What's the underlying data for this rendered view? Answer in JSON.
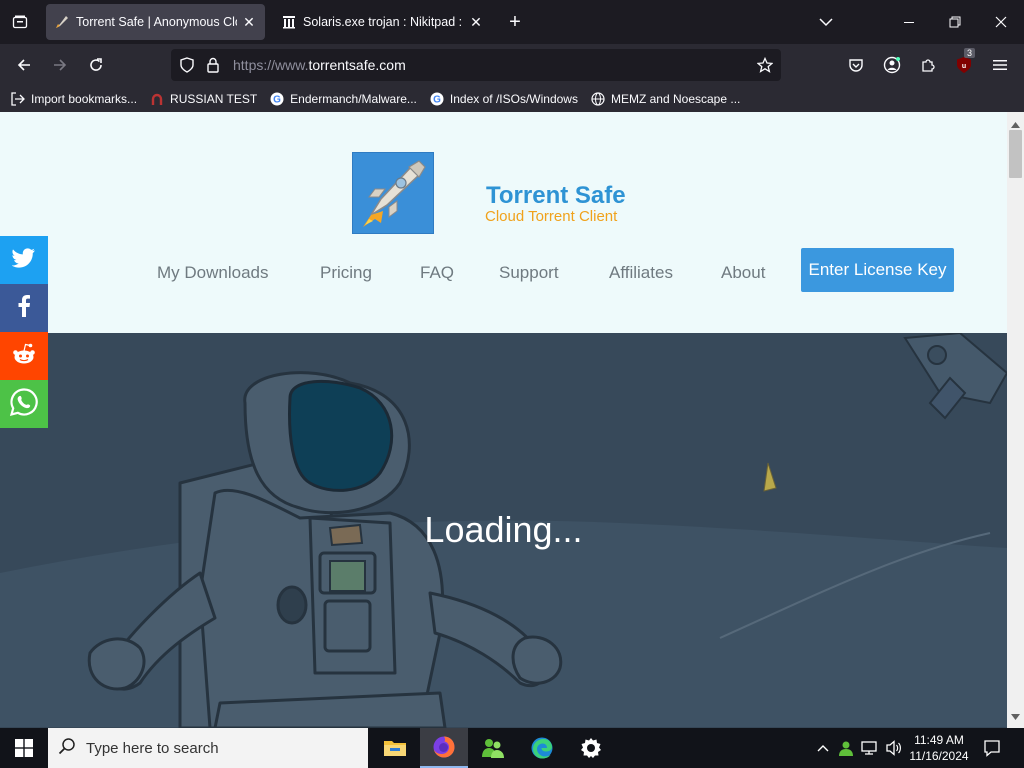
{
  "browser": {
    "tabs": [
      {
        "title": "Torrent Safe | Anonymous Cloud",
        "active": true
      },
      {
        "title": "Solaris.exe trojan : Nikitpad : Fr",
        "active": false
      }
    ],
    "url_prefix": "https://www.",
    "url_domain": "torrentsafe.com",
    "notification_badge": "3",
    "bookmarks": [
      {
        "label": "Import bookmarks...",
        "icon": "import-icon"
      },
      {
        "label": "RUSSIAN TEST",
        "icon": "horseshoe-icon"
      },
      {
        "label": "Endermanch/Malware...",
        "icon": "google-icon"
      },
      {
        "label": "Index of /ISOs/Windows",
        "icon": "google-icon"
      },
      {
        "label": "MEMZ and Noescape ...",
        "icon": "globe-icon"
      }
    ]
  },
  "site": {
    "brand_name": "Torrent Safe",
    "brand_tagline": "Cloud Torrent Client",
    "nav": [
      "My Downloads",
      "Pricing",
      "FAQ",
      "Support",
      "Affiliates",
      "About"
    ],
    "cta": "Enter License Key",
    "loading_text": "Loading...",
    "share": [
      {
        "name": "twitter",
        "color": "#1da1f2"
      },
      {
        "name": "facebook",
        "color": "#3b5998"
      },
      {
        "name": "reddit",
        "color": "#ff4500"
      },
      {
        "name": "whatsapp",
        "color": "#4dc247"
      }
    ],
    "colors": {
      "header_bg": "#eefafb",
      "hero_bg": "#37495a",
      "cta_bg": "#3b98df",
      "brand_blue": "#2e93d4",
      "brand_orange": "#f0a21c"
    }
  },
  "taskbar": {
    "search_placeholder": "Type here to search",
    "apps": [
      "file-explorer-icon",
      "firefox-icon",
      "people-icon",
      "edge-icon",
      "settings-icon"
    ],
    "time": "11:49 AM",
    "date": "11/16/2024"
  }
}
